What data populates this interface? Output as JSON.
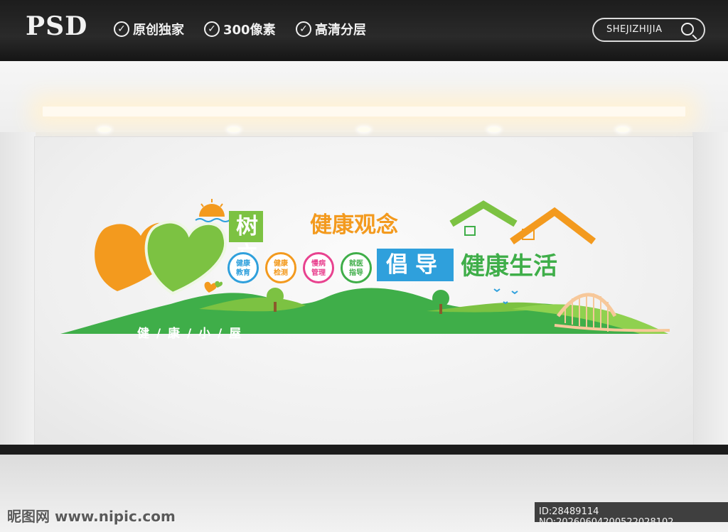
{
  "header": {
    "logo": "PSD",
    "features": [
      "原创独家",
      "300像素",
      "高清分层"
    ],
    "search_text": "SHEJIZHIJIA"
  },
  "signage": {
    "line1_part1": "树立",
    "line1_part2": "健康观念",
    "line2_part1": "倡导",
    "line2_part2": "健康生活",
    "badges": [
      {
        "l1": "健康",
        "l2": "教育",
        "color": "#2fa0dc"
      },
      {
        "l1": "健康",
        "l2": "检测",
        "color": "#f39a1e"
      },
      {
        "l1": "慢病",
        "l2": "管理",
        "color": "#e8428f"
      },
      {
        "l1": "就医",
        "l2": "指导",
        "color": "#3fae49"
      }
    ],
    "ground_label": "健 / 康 / 小 / 屋"
  },
  "colors": {
    "green": "#3fae49",
    "light_green": "#7cc242",
    "orange": "#f39a1e",
    "blue": "#2fa0dc"
  },
  "watermark": {
    "left": "昵图网 www.nipic.com",
    "right": "ID:28489114 NO:20260604200522028102"
  }
}
